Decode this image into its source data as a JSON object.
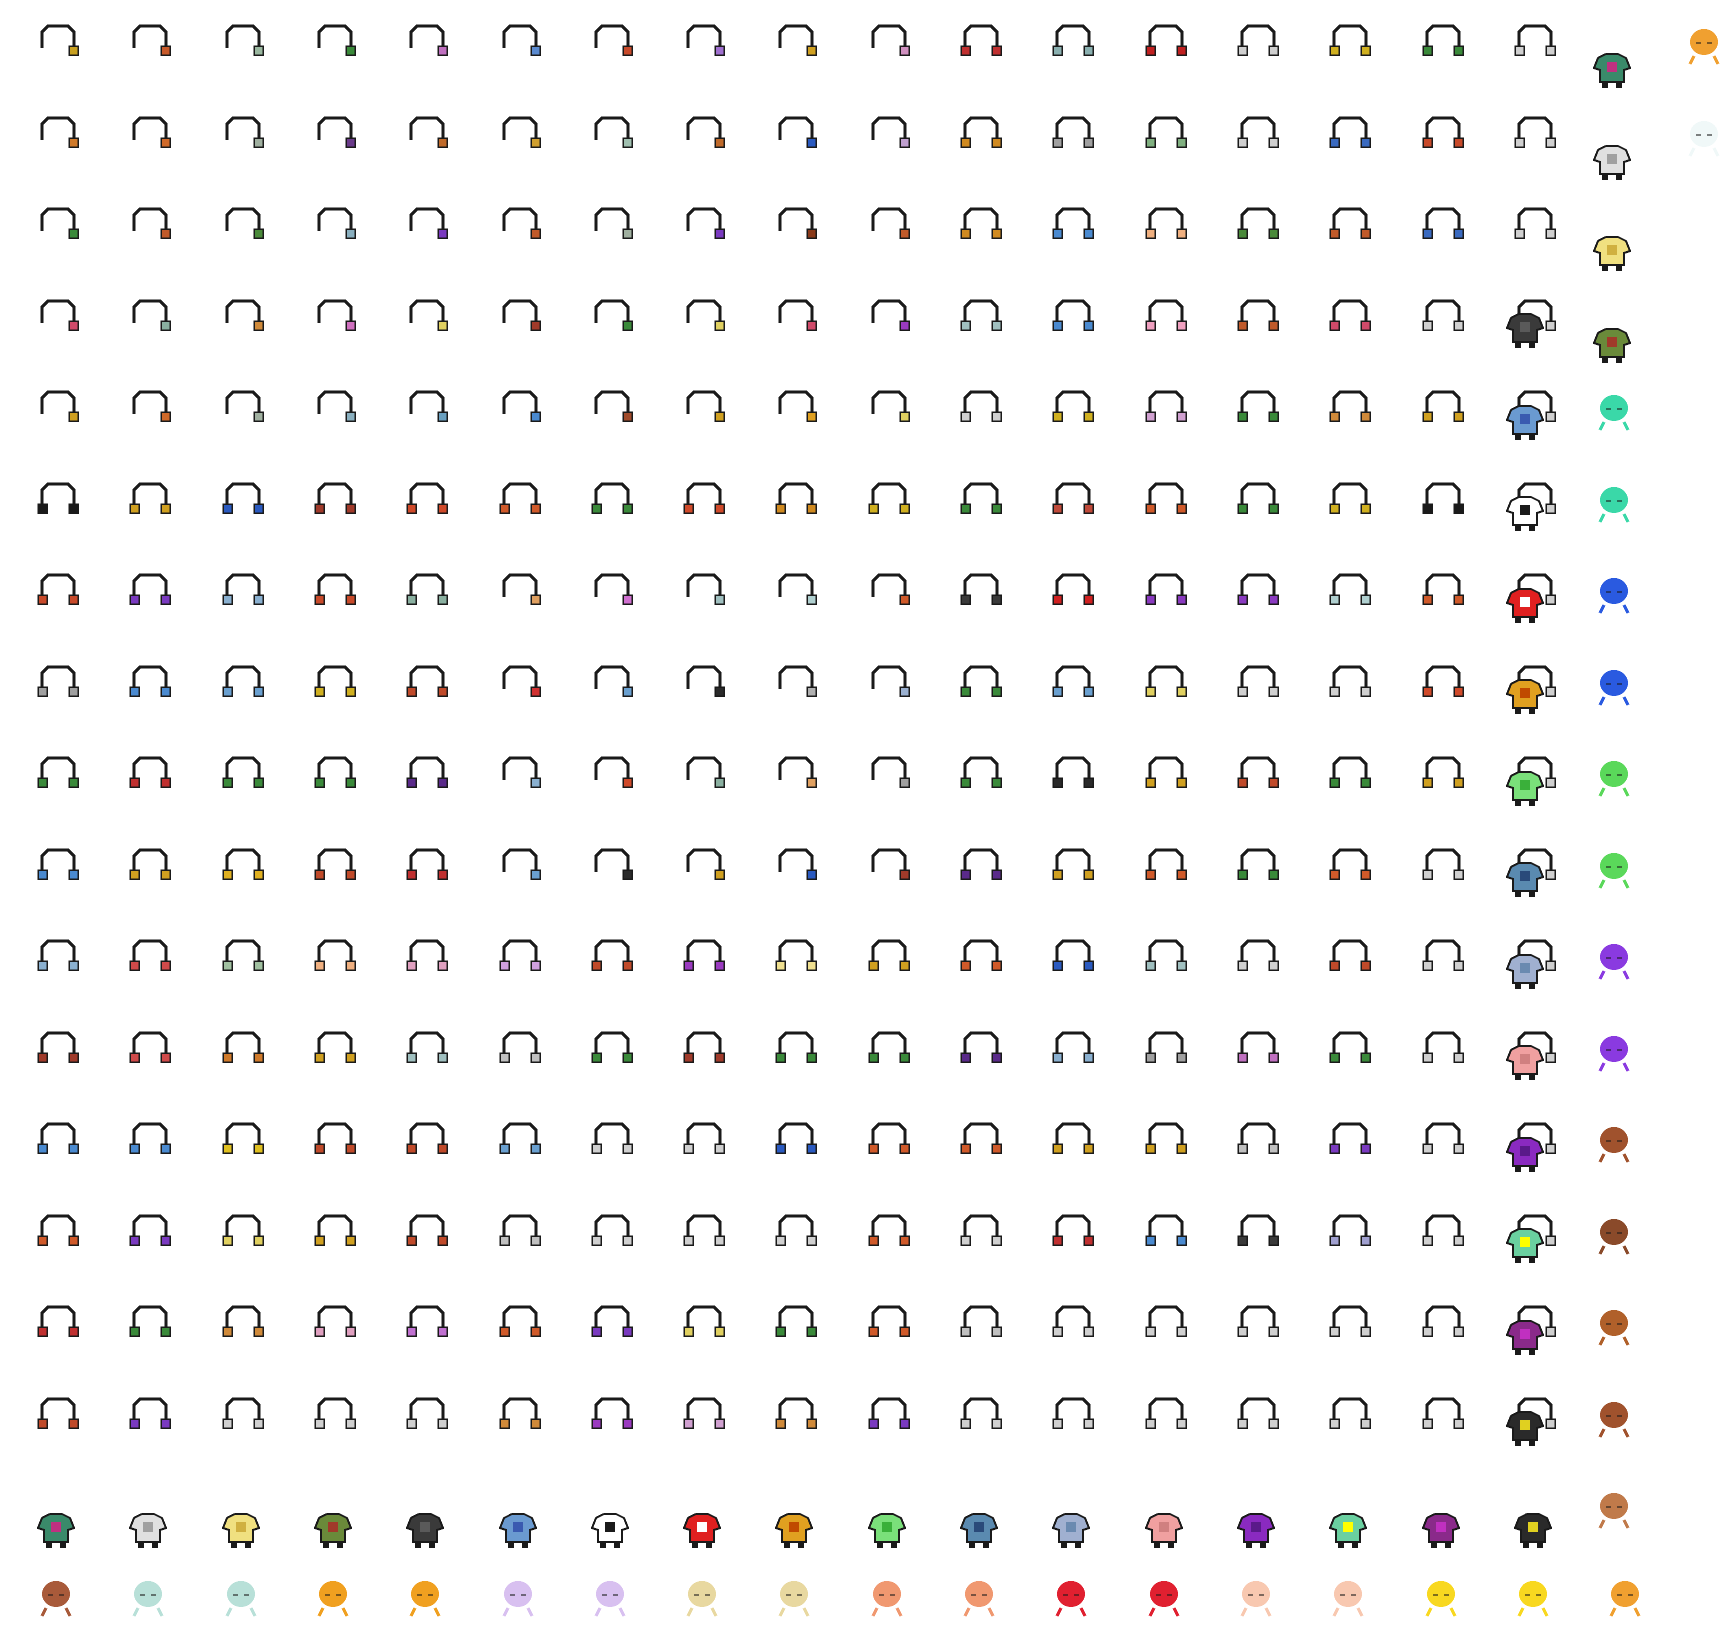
{
  "sheet": {
    "background": "#ffffff",
    "outline_color": "#1a1a1a",
    "headphone_grid_columns": 17,
    "headphone_grid_rows": 16,
    "headphone_pad_colors": [
      [
        "#c8a020",
        "#c85a2a",
        "#9ab8a0",
        "#3a8a3a",
        "#c070c0",
        "#5a8ad0",
        "#c84a2a",
        "#a070d0",
        "#d0a020",
        "#d090c0",
        "#c03030",
        "#8ab0b0",
        "#c02020",
        "#d0d0d0",
        "#d0b020",
        "#3a8a3a",
        "#d0d0d0"
      ],
      [
        "#d07a2a",
        "#d06a2a",
        "#a0b0a0",
        "#6a3a8a",
        "#c06a2a",
        "#d0a030",
        "#a0c0b0",
        "#c06a2a",
        "#2a5ac0",
        "#c0a0d0",
        "#d08a20",
        "#a0a0a0",
        "#80b080",
        "#d0d0d0",
        "#3a6ac0",
        "#c84a2a",
        "#d0d0d0"
      ],
      [
        "#3a8a3a",
        "#c05a2a",
        "#4a8a3a",
        "#8ab0c0",
        "#7a3ac0",
        "#c05a2a",
        "#a0b0a0",
        "#7a3ac0",
        "#8a3a1a",
        "#c05a2a",
        "#d08a20",
        "#4a8ad0",
        "#f0b080",
        "#4a8a3a",
        "#c05a2a",
        "#3a6ac0",
        "#d0d0d0"
      ],
      [
        "#d04a6a",
        "#8ab0a0",
        "#d08a3a",
        "#d070c0",
        "#e0d060",
        "#a03a2a",
        "#3a8a3a",
        "#e0d060",
        "#d04a6a",
        "#9a3ac0",
        "#a0c0c0",
        "#4a8ad0",
        "#f0a0c0",
        "#c05a2a",
        "#d04a6a",
        "#d0d0d0",
        "#d0d0d0"
      ],
      [
        "#d0a020",
        "#d06a2a",
        "#a0b0a0",
        "#8ab0c0",
        "#6aa0c0",
        "#4a8ad0",
        "#a04a2a",
        "#d0a020",
        "#e0a020",
        "#e0d060",
        "#d0d0d0",
        "#d0b020",
        "#d0a0d0",
        "#3a8a3a",
        "#d08a3a",
        "#d0a020",
        "#d0d0d0"
      ],
      [
        "#1a1a1a",
        "#d0a020",
        "#2a5ac0",
        "#a03a2a",
        "#d04a2a",
        "#d05a2a",
        "#3a8a3a",
        "#d04a2a",
        "#d08a20",
        "#d0b020",
        "#3a8a3a",
        "#c04a3a",
        "#d05a2a",
        "#3a8a3a",
        "#d0b020",
        "#1a1a1a",
        "#d0d0d0"
      ],
      [
        "#c84a2a",
        "#7a3ac0",
        "#8ab0d0",
        "#c84a2a",
        "#8ab0a0",
        "#e0a060",
        "#d070d0",
        "#a0c0c0",
        "#b0d0d0",
        "#d05a2a",
        "#3a3a3a",
        "#d02020",
        "#8a3ac0",
        "#8a3ac0",
        "#b0d0d0",
        "#d05a2a",
        "#d0d0d0"
      ],
      [
        "#a0a0a0",
        "#4a8ad0",
        "#6aa0d0",
        "#d0b020",
        "#c04a2a",
        "#d03030",
        "#6aa0d0",
        "#2a2a2a",
        "#b0b0b0",
        "#9ab0d0",
        "#3a8a3a",
        "#6aa0d0",
        "#e0d060",
        "#d0d0d0",
        "#d0d0d0",
        "#d04a2a",
        "#d0d0d0"
      ],
      [
        "#3a8a3a",
        "#c03030",
        "#3a8a3a",
        "#3a8a3a",
        "#5a2a8a",
        "#8ab0d0",
        "#d04a2a",
        "#8ab0a0",
        "#e0a060",
        "#a0a0a0",
        "#3a8a3a",
        "#2a2a2a",
        "#d0a020",
        "#c04a2a",
        "#3a8a3a",
        "#d0a020",
        "#d0d0d0"
      ],
      [
        "#4a8ad0",
        "#d0a020",
        "#e0b020",
        "#c04a2a",
        "#c03030",
        "#6aa0d0",
        "#2a2a2a",
        "#d0a020",
        "#2a5ac0",
        "#a03a2a",
        "#5a2a8a",
        "#d0a020",
        "#d05a2a",
        "#3a8a3a",
        "#d05a2a",
        "#d0d0d0",
        "#d0d0d0"
      ],
      [
        "#8ab0d0",
        "#d04a4a",
        "#a0c0a0",
        "#f0b080",
        "#e0a0c0",
        "#d0a0e0",
        "#c04a2a",
        "#9a3ac0",
        "#f0e090",
        "#d0a020",
        "#d05a2a",
        "#2a5ac0",
        "#a0c0c0",
        "#d0d0d0",
        "#c04a2a",
        "#d0d0d0",
        "#d0d0d0"
      ],
      [
        "#a03a2a",
        "#d04a4a",
        "#d07a2a",
        "#d0a020",
        "#a0c0c0",
        "#c0c0c0",
        "#3a8a3a",
        "#a03a2a",
        "#3a8a3a",
        "#3a8a3a",
        "#5a2a8a",
        "#8ab0d0",
        "#a0a0a0",
        "#c070c0",
        "#3a8a3a",
        "#d0d0d0",
        "#d0d0d0"
      ],
      [
        "#4a8ad0",
        "#4a8ad0",
        "#e0c020",
        "#c04a2a",
        "#c04a2a",
        "#6aa0d0",
        "#d0d0d0",
        "#d0d0d0",
        "#2a5ac0",
        "#d05a2a",
        "#d05a2a",
        "#d0a020",
        "#d0a020",
        "#c0c0c0",
        "#7a3ac0",
        "#d0d0d0",
        "#d0d0d0"
      ],
      [
        "#d05a2a",
        "#7a3ac0",
        "#e0d060",
        "#d0a020",
        "#c04a2a",
        "#c0c0c0",
        "#d0d0d0",
        "#d0d0d0",
        "#d0d0d0",
        "#d05a2a",
        "#d0d0d0",
        "#c03030",
        "#4a8ad0",
        "#3a3a3a",
        "#a0a0d0",
        "#d0d0d0",
        "#d0d0d0"
      ],
      [
        "#c03030",
        "#3a8a3a",
        "#d08a3a",
        "#e0a0c0",
        "#c070d0",
        "#d05a2a",
        "#7a3ac0",
        "#e0d060",
        "#3a8a3a",
        "#d05a2a",
        "#c0c0c0",
        "#d0d0d0",
        "#d0d0d0",
        "#d0d0d0",
        "#d0d0d0",
        "#d0d0d0",
        "#d0d0d0"
      ],
      [
        "#c04a2a",
        "#7a3ac0",
        "#d0d0d0",
        "#d0d0d0",
        "#d0d0d0",
        "#d08a3a",
        "#9a3ac0",
        "#d0a0d0",
        "#d08a3a",
        "#7a3ac0",
        "#d0d0d0",
        "#d0d0d0",
        "#d0d0d0",
        "#d0d0d0",
        "#d0d0d0",
        "#d0d0d0",
        "#d0d0d0"
      ]
    ],
    "shirt_colors": [
      "#3a8a6a",
      "#e0e0e0",
      "#f0e080",
      "#6a8a3a",
      "#3a3a3a",
      "#6a9ad0",
      "#ffffff",
      "#e02020",
      "#e0a020",
      "#7ae07a",
      "#5a8ab0",
      "#a0b0d0",
      "#f0a0a0",
      "#8a2ac0",
      "#6ad0a0",
      "#8a2a8a",
      "#2a2a2a"
    ],
    "shirt_accent_colors": [
      "#c03080",
      "#a0a0a0",
      "#d0b040",
      "#a03a2a",
      "#5a5a5a",
      "#3a5ab0",
      "#1a1a1a",
      "#ffffff",
      "#c04a00",
      "#3ab03a",
      "#2a4a7a",
      "#6a8ab0",
      "#d08080",
      "#5a1a8a",
      "#ffff00",
      "#c030c0",
      "#e0d020"
    ],
    "body_colors_bottom": [
      "#a85a3a",
      "#b8e0d8",
      "#b8e0d8",
      "#f0a020",
      "#f0a020",
      "#d8c0f0",
      "#d8c0f0",
      "#e8d8a0",
      "#e8d8a0",
      "#f09870",
      "#f09870",
      "#e02030",
      "#e02030",
      "#f8c8b0",
      "#f8c8b0",
      "#f8d820",
      "#f8d820",
      "#f0a030"
    ],
    "body_colors_right": [
      "#3ad8a8",
      "#3ad8a8",
      "#2a5ae0",
      "#2a5ae0",
      "#5ad85a",
      "#5ad85a",
      "#8a3ae0",
      "#8a3ae0",
      "#a0522d",
      "#8a4a2a",
      "#b0602a",
      "#a0522d",
      "#c07a4a"
    ],
    "corner_body_colors": [
      "#f0a030",
      "#f0f8f8"
    ]
  }
}
